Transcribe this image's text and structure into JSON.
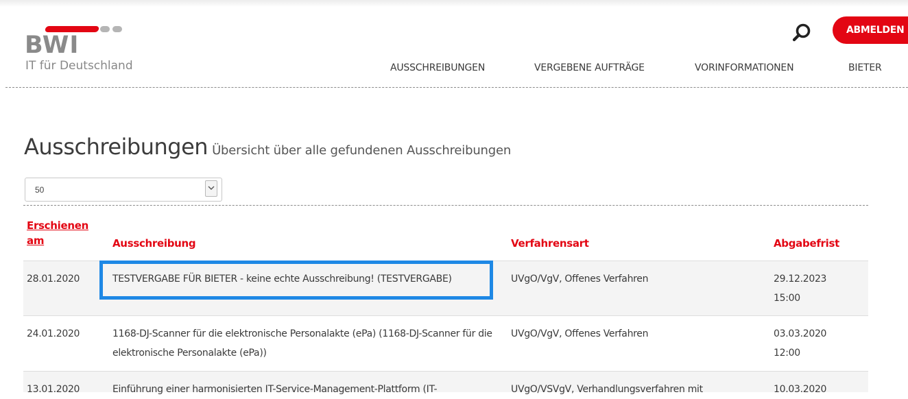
{
  "header": {
    "logo_text": "BWI",
    "tagline": "IT für Deutschland",
    "search_icon": "search-icon",
    "logout_label": "ABMELDEN",
    "nav": [
      "AUSSCHREIBUNGEN",
      "VERGEBENE AUFTRÄGE",
      "VORINFORMATIONEN",
      "BIETER"
    ]
  },
  "page": {
    "title": "Ausschreibungen",
    "subtitle": "Übersicht über alle gefundenen Ausschreibungen"
  },
  "pagesize": {
    "selected": "50"
  },
  "table": {
    "headers": [
      "Erschienen am",
      "Ausschreibung",
      "Verfahrensart",
      "Abgabefrist"
    ],
    "rows": [
      {
        "date": "28.01.2020",
        "title": "TESTVERGABE FÜR BIETER - keine echte Ausschreibung! (TESTVERGABE)",
        "procedure": "UVgO/VgV, Offenes Verfahren",
        "deadline": "29.12.2023 15:00"
      },
      {
        "date": "24.01.2020",
        "title": "1168-DJ-Scanner für die elektronische Personalakte (ePa) (1168-DJ-Scanner für die elektronische Personalakte (ePa))",
        "procedure": "UVgO/VgV, Offenes Verfahren",
        "deadline": "03.03.2020 12:00"
      },
      {
        "date": "13.01.2020",
        "title": "Einführung einer harmonisierten IT-Service-Management-Plattform (IT-",
        "procedure": "UVgO/VSVgV, Verhandlungsverfahren mit",
        "deadline": "10.03.2020"
      }
    ]
  },
  "colors": {
    "accent": "#e30613",
    "highlight": "#1e88e5"
  }
}
